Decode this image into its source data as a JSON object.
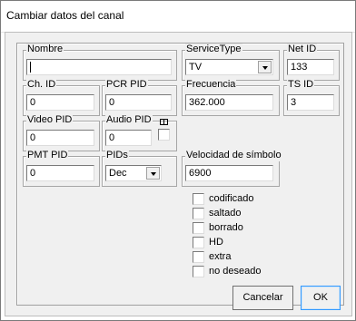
{
  "window": {
    "title": "Cambiar datos del canal"
  },
  "fields": {
    "nombre": {
      "label": "Nombre",
      "value": ""
    },
    "service_type": {
      "label": "ServiceType",
      "value": "TV"
    },
    "net_id": {
      "label": "Net ID",
      "value": "133"
    },
    "ch_id": {
      "label": "Ch. ID",
      "value": "0"
    },
    "pcr_pid": {
      "label": "PCR PID",
      "value": "0"
    },
    "frecuencia": {
      "label": "Frecuencia",
      "value": "362.000"
    },
    "ts_id": {
      "label": "TS ID",
      "value": "3"
    },
    "video_pid": {
      "label": "Video PID",
      "value": "0"
    },
    "audio_pid": {
      "label": "Audio PID",
      "value": "0"
    },
    "pmt_pid": {
      "label": "PMT PID",
      "value": "0"
    },
    "pids": {
      "label": "PIDs",
      "value": "Dec"
    },
    "velocidad": {
      "label": "Velocidad de símbolo",
      "value": "6900"
    }
  },
  "checkboxes": [
    {
      "label": "codificado",
      "checked": false
    },
    {
      "label": "saltado",
      "checked": false
    },
    {
      "label": "borrado",
      "checked": false
    },
    {
      "label": "HD",
      "checked": false
    },
    {
      "label": "extra",
      "checked": false
    },
    {
      "label": "no deseado",
      "checked": false
    }
  ],
  "buttons": {
    "cancel": "Cancelar",
    "ok": "OK"
  },
  "icons": {
    "audio_toggle": "audio-track-icon"
  }
}
